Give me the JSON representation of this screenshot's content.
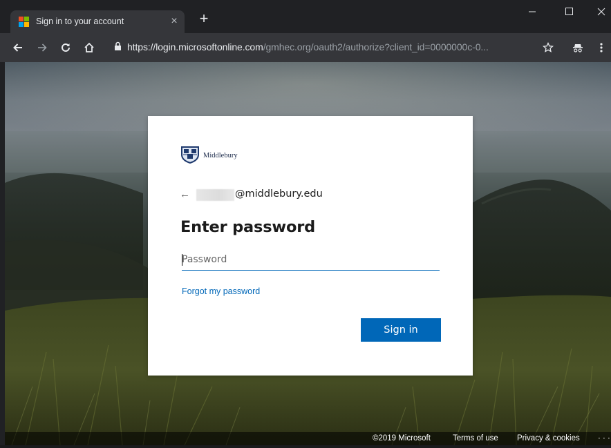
{
  "browser": {
    "tab": {
      "title": "Sign in to your account",
      "close_label": "×",
      "favicon": "microsoft-logo-icon",
      "favicon_colors": [
        "#f25022",
        "#7fba00",
        "#00a4ef",
        "#ffb900"
      ]
    },
    "new_tab_label": "+",
    "address": {
      "host": "https://login.microsoftonline.com",
      "path": "/gmhec.org/oauth2/authorize?client_id=0000000c-0..."
    },
    "toolbar_icons": [
      "back-icon",
      "forward-icon",
      "reload-icon",
      "home-icon",
      "lock-icon",
      "star-icon",
      "incognito-icon",
      "menu-icon"
    ],
    "window_controls": [
      "minimize-icon",
      "maximize-icon",
      "close-icon"
    ]
  },
  "dialog": {
    "logo_text": "Middlebury",
    "back_arrow": "←",
    "identity_suffix": "@middlebury.edu",
    "heading": "Enter password",
    "password_placeholder": "Password",
    "forgot_link": "Forgot my password",
    "signin_button": "Sign in",
    "accent_color": "#0067b8"
  },
  "footer": {
    "copyright": "©2019 Microsoft",
    "terms": "Terms of use",
    "privacy": "Privacy & cookies",
    "more": "· · ·"
  }
}
